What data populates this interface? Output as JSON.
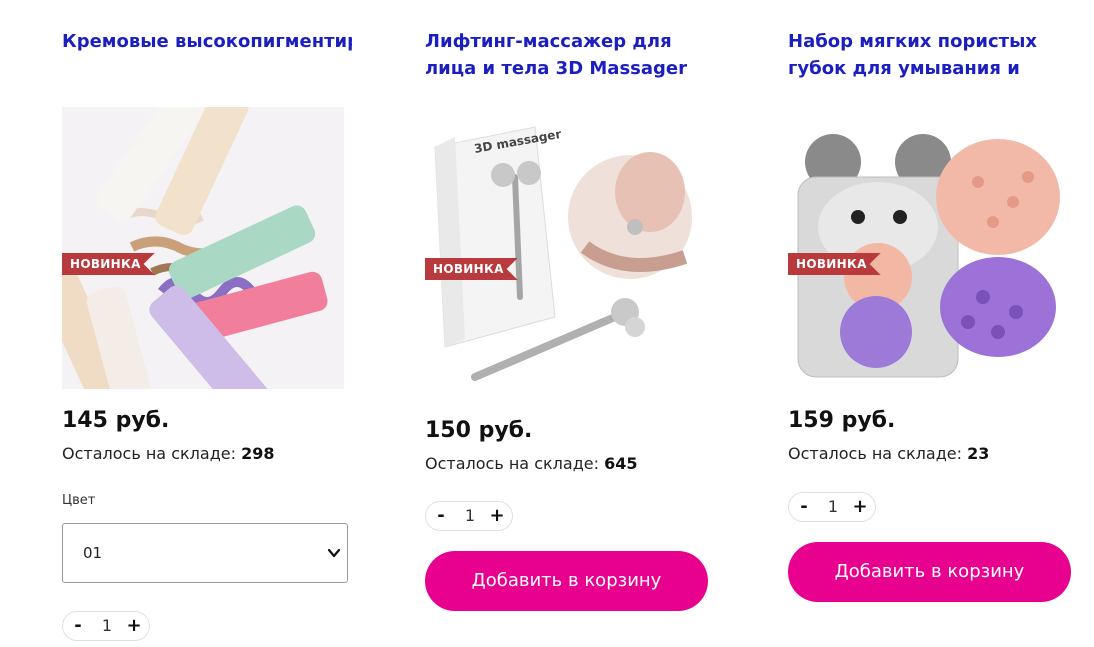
{
  "products": [
    {
      "title": "Кремовые высокопигментированные",
      "image_alt": "tubes-photo",
      "badge": "НОВИНКА",
      "price": "145 руб.",
      "stock_label": "Осталось на складе: ",
      "stock_value": "298",
      "color_label": "Цвет",
      "color_selected": "01",
      "qty": "1",
      "minus": "-",
      "plus": "+"
    },
    {
      "title": "Лифтинг-массажер для лица и тела 3D Massager",
      "badge": "НОВИНКА",
      "price": "150 руб.",
      "stock_label": "Осталось на складе: ",
      "stock_value": "645",
      "qty": "1",
      "minus": "-",
      "plus": "+",
      "button": "Добавить в корзину",
      "box_text": "3D massager"
    },
    {
      "title": "Набор мягких пористых губок для умывания и",
      "badge": "НОВИНКА",
      "price": "159 руб.",
      "stock_label": "Осталось на складе: ",
      "stock_value": "23",
      "qty": "1",
      "minus": "-",
      "plus": "+",
      "button": "Добавить в корзину"
    }
  ],
  "colors": {
    "title": "#1c1fbf",
    "badge": "#b83a3c",
    "button": "#e8008e"
  },
  "icons": {
    "select_arrow": "chevron-down-icon"
  }
}
